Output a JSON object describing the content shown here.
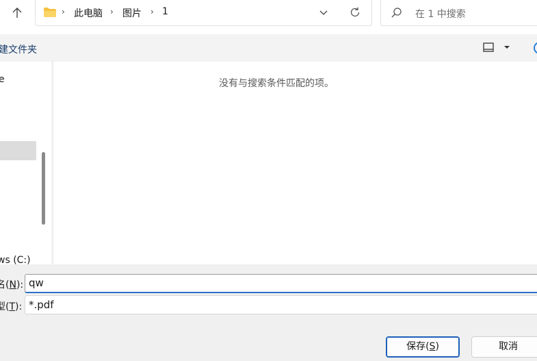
{
  "address": {
    "crumbs": [
      "此电脑",
      "图片",
      "1"
    ]
  },
  "search": {
    "placeholder": "在 1 中搜索"
  },
  "command_bar": {
    "new_folder": "建文件夹"
  },
  "nav": {
    "item_partial_top": "e",
    "item_drive": "ws (C:)"
  },
  "content": {
    "empty_message": "没有与搜索条件匹配的项。"
  },
  "form": {
    "name_label_prefix": "名(",
    "name_label_key": "N",
    "name_label_suffix": "):",
    "name_value": "qw",
    "type_label_prefix": "型(",
    "type_label_key": "T",
    "type_label_suffix": "):",
    "type_value": "*.pdf"
  },
  "buttons": {
    "save_prefix": "保存(",
    "save_key": "S",
    "save_suffix": ")",
    "cancel": "取消"
  },
  "icons": {
    "up": "arrow-up-icon",
    "folder": "folder-icon",
    "dropdown": "chevron-down-icon",
    "refresh": "refresh-icon",
    "search": "search-icon",
    "view": "view-icon"
  },
  "colors": {
    "accent": "#1d5fb8",
    "folder": "#f5c242"
  }
}
